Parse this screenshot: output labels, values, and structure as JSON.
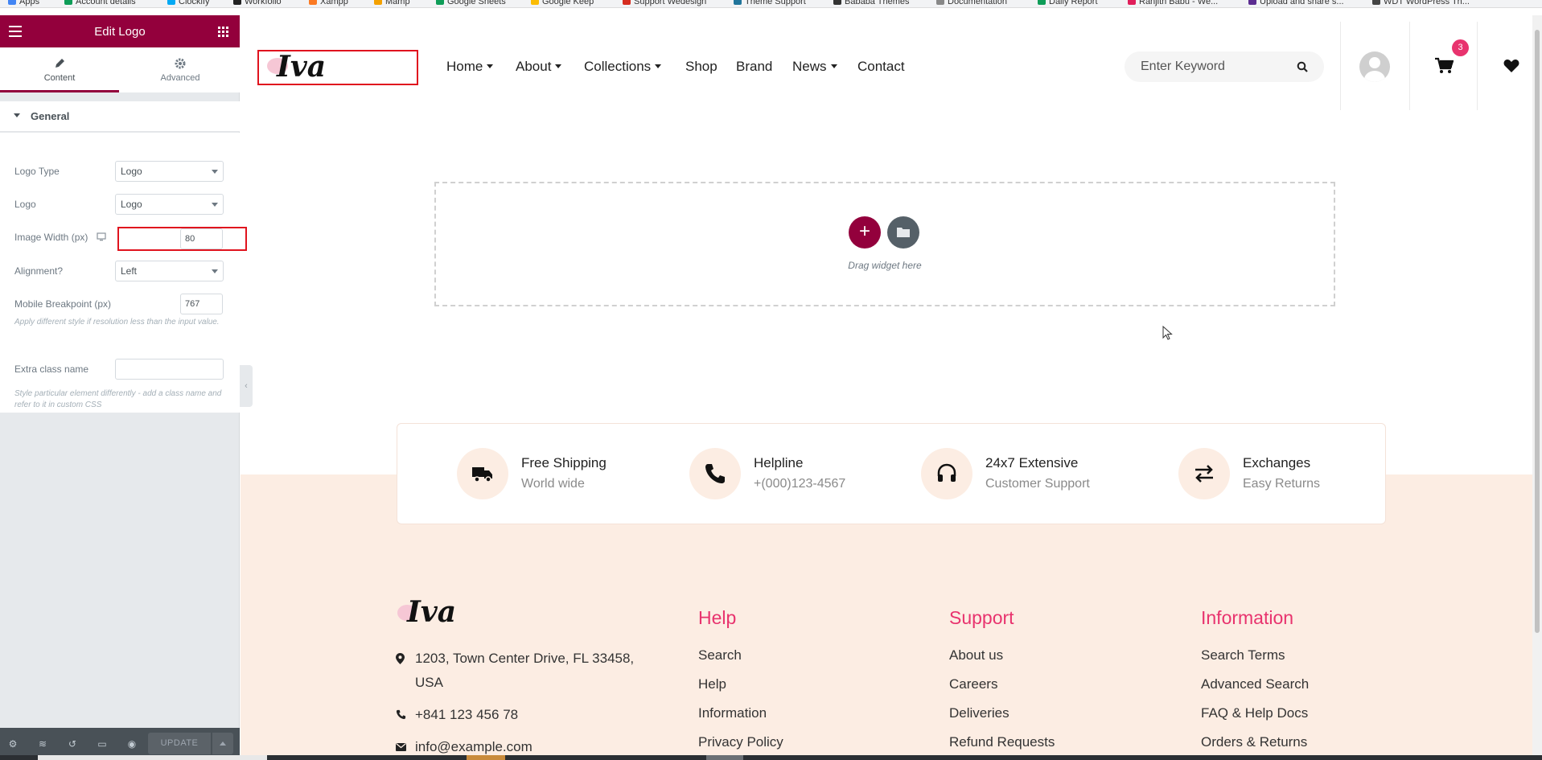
{
  "bookmarks": [
    "Apps",
    "Account details",
    "Clockify",
    "Workfollo",
    "Xampp",
    "Mamp",
    "Google Sheets",
    "Google Keep",
    "Support Wedesign",
    "Theme Support",
    "Bababa Themes",
    "Documentation",
    "Daily Report",
    "Ranjith Babu - We...",
    "Upload and share s...",
    "WDT WordPress Th..."
  ],
  "panel": {
    "title": "Edit Logo",
    "tabs": {
      "content": "Content",
      "advanced": "Advanced"
    },
    "section": "General",
    "controls": {
      "logo_type": {
        "label": "Logo Type",
        "value": "Logo"
      },
      "logo": {
        "label": "Logo",
        "value": "Logo"
      },
      "image_width": {
        "label": "Image Width (px)",
        "value": "80"
      },
      "alignment": {
        "label": "Alignment?",
        "value": "Left"
      },
      "mobile_breakpoint": {
        "label": "Mobile Breakpoint (px)",
        "value": "767",
        "note": "Apply different style if resolution less than the input value."
      },
      "extra_class": {
        "label": "Extra class name",
        "value": "",
        "note": "Style particular element differently - add a class name and refer to it in custom CSS"
      }
    },
    "footer": {
      "update_label": "UPDATE"
    }
  },
  "site": {
    "logo_text": "Iva",
    "nav": [
      {
        "label": "Home",
        "dropdown": true
      },
      {
        "label": "About",
        "dropdown": true
      },
      {
        "label": "Collections",
        "dropdown": true
      },
      {
        "label": "Shop",
        "dropdown": false
      },
      {
        "label": "Brand",
        "dropdown": false
      },
      {
        "label": "News",
        "dropdown": true
      },
      {
        "label": "Contact",
        "dropdown": false
      }
    ],
    "search_placeholder": "Enter Keyword",
    "cart_count": "3",
    "dropzone_text": "Drag widget here",
    "add_symbol": "+"
  },
  "features": [
    {
      "title": "Free Shipping",
      "subtitle": "World wide",
      "icon": "truck-icon"
    },
    {
      "title": "Helpline",
      "subtitle": "+(000)123-4567",
      "icon": "phone-icon"
    },
    {
      "title": "24x7 Extensive",
      "subtitle": "Customer Support",
      "icon": "headphones-icon"
    },
    {
      "title": "Exchanges",
      "subtitle": "Easy Returns",
      "icon": "exchange-icon"
    }
  ],
  "footer": {
    "address": "1203, Town Center Drive, FL 33458, USA",
    "phone": "+841 123 456 78",
    "email": "info@example.com",
    "columns": [
      {
        "heading": "Help",
        "links": [
          "Search",
          "Help",
          "Information",
          "Privacy Policy"
        ]
      },
      {
        "heading": "Support",
        "links": [
          "About us",
          "Careers",
          "Deliveries",
          "Refund Requests"
        ]
      },
      {
        "heading": "Information",
        "links": [
          "Search Terms",
          "Advanced Search",
          "FAQ & Help Docs",
          "Orders & Returns"
        ]
      }
    ]
  },
  "colors": {
    "brand": "#93003c",
    "accent": "#e8336e",
    "peach": "#fcede3",
    "highlight": "#e0131e"
  }
}
